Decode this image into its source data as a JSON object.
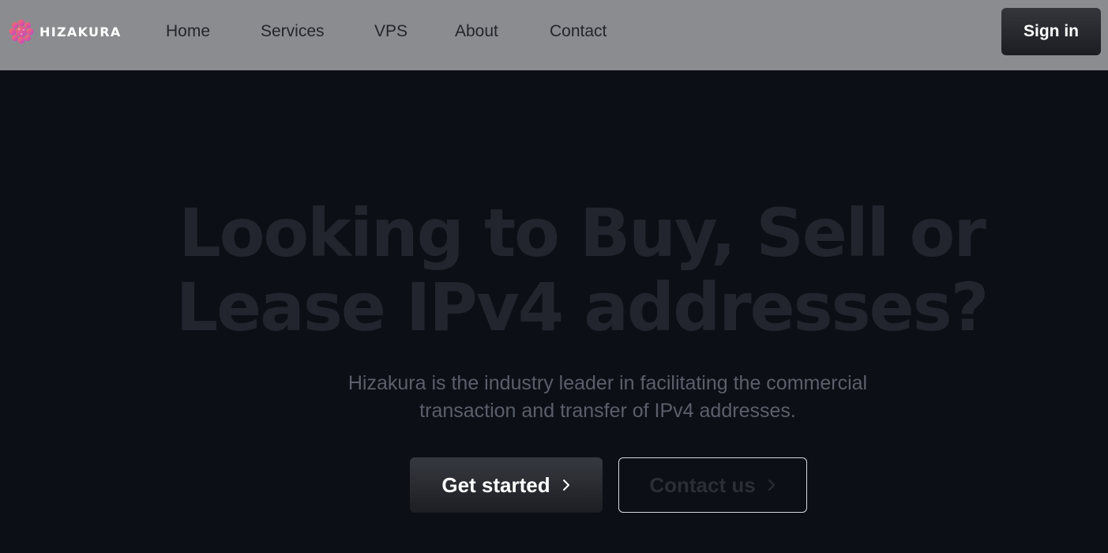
{
  "header": {
    "brand": "HIZAKURA",
    "nav": [
      {
        "label": "Home",
        "name": "nav-link-home"
      },
      {
        "label": "Services",
        "name": "nav-link-services"
      },
      {
        "label": "VPS",
        "name": "nav-link-vps"
      },
      {
        "label": "About",
        "name": "nav-link-about"
      },
      {
        "label": "Contact",
        "name": "nav-link-contact"
      }
    ],
    "sign_in_label": "Sign in"
  },
  "hero": {
    "title_line1": "Looking to Buy, Sell or",
    "title_line2": "Lease IPv4 addresses?",
    "subtitle_line1": "Hizakura is the industry leader in facilitating the commercial",
    "subtitle_line2": "transaction and transfer of IPv4 addresses.",
    "primary_cta_label": "Get started",
    "primary_cta_icon": "chevron-right-icon",
    "secondary_cta_label": "Contact us",
    "secondary_cta_icon": "chevron-right-icon"
  },
  "colors": {
    "header_bg": "#8b8c90",
    "page_bg": "#0c0f16",
    "logo_pink": "#e8559a",
    "logo_orange": "#f08a4b"
  }
}
